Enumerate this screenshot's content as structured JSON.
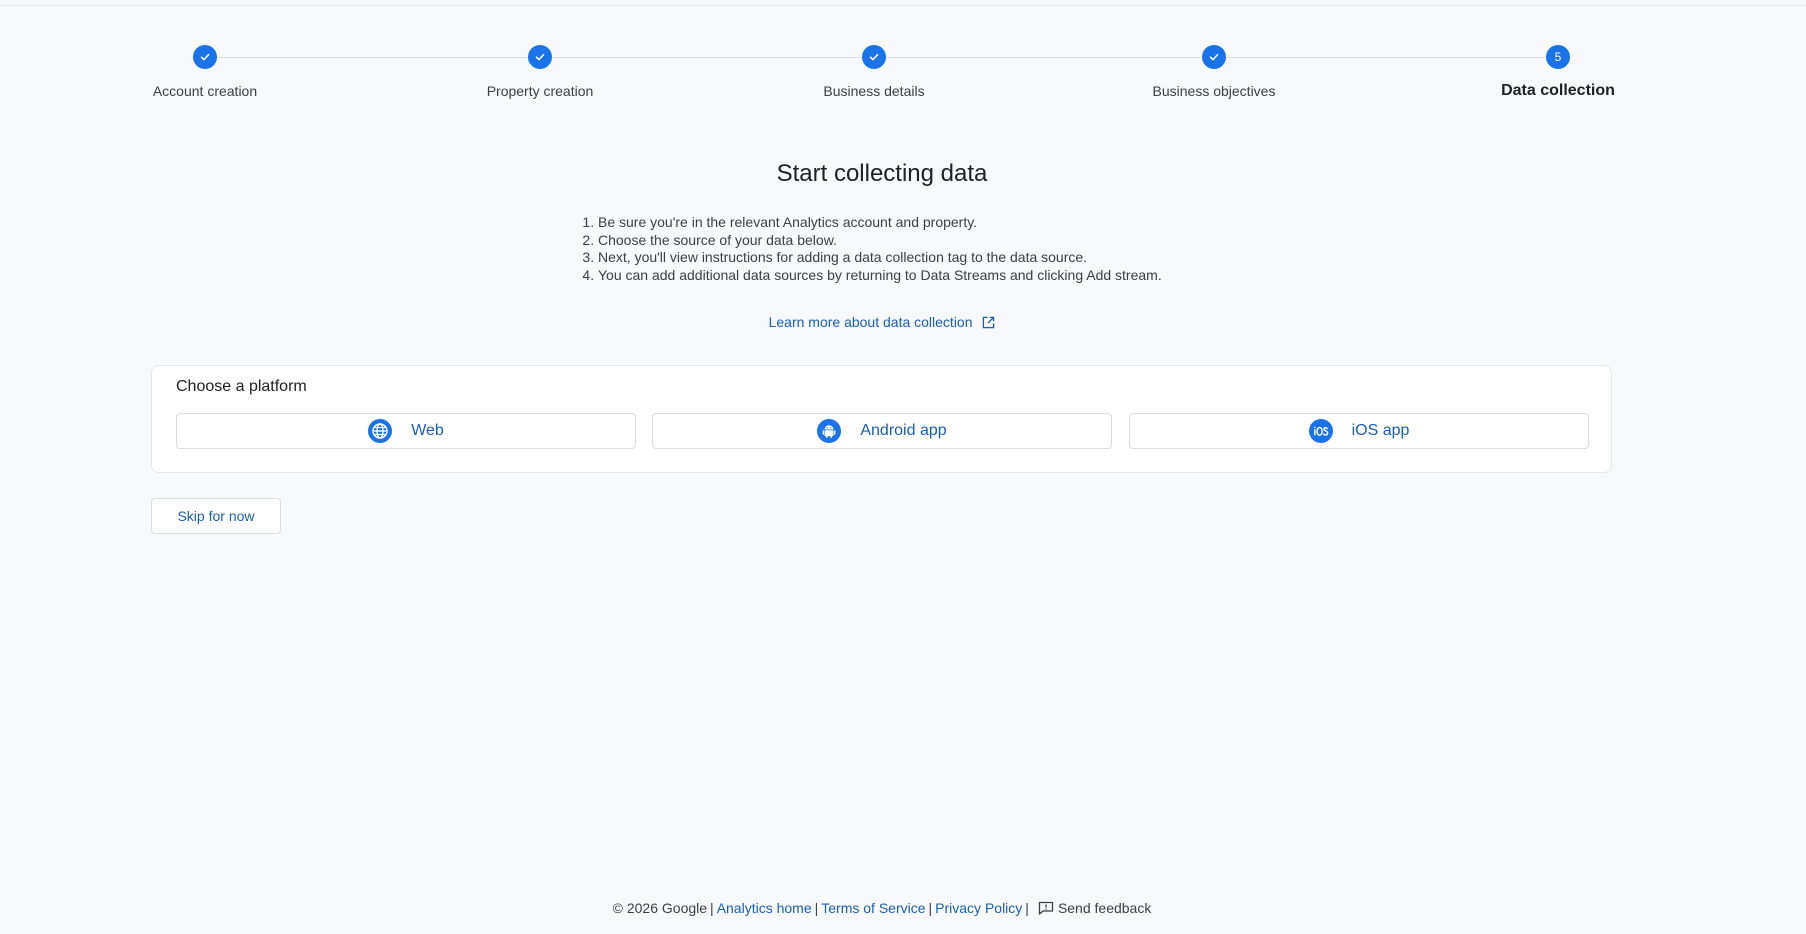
{
  "stepper": {
    "steps": [
      {
        "label": "Account creation",
        "state": "completed"
      },
      {
        "label": "Property creation",
        "state": "completed"
      },
      {
        "label": "Business details",
        "state": "completed"
      },
      {
        "label": "Business objectives",
        "state": "completed"
      },
      {
        "label": "Data collection",
        "state": "current",
        "number": "5"
      }
    ]
  },
  "main": {
    "headline": "Start collecting data",
    "instructions": [
      "Be sure you're in the relevant Analytics account and property.",
      "Choose the source of your data below.",
      "Next, you'll view instructions for adding a data collection tag to the data source.",
      "You can add additional data sources by returning to Data Streams and clicking Add stream."
    ],
    "learn_more": "Learn more about data collection",
    "learn_more_icon": "open-in-new-icon"
  },
  "platform": {
    "title": "Choose a platform",
    "options": [
      {
        "label": "Web",
        "icon": "globe-icon"
      },
      {
        "label": "Android app",
        "icon": "android-icon"
      },
      {
        "label": "iOS app",
        "icon": "ios-icon"
      }
    ]
  },
  "skip_button": "Skip for now",
  "footer": {
    "copyright": "© 2026 Google",
    "links": [
      "Analytics home",
      "Terms of Service",
      "Privacy Policy"
    ],
    "feedback": "Send feedback",
    "feedback_icon": "feedback-icon"
  },
  "colors": {
    "accent": "#1a73e8",
    "link": "#1a5fb4",
    "background": "#f7f9fb"
  }
}
